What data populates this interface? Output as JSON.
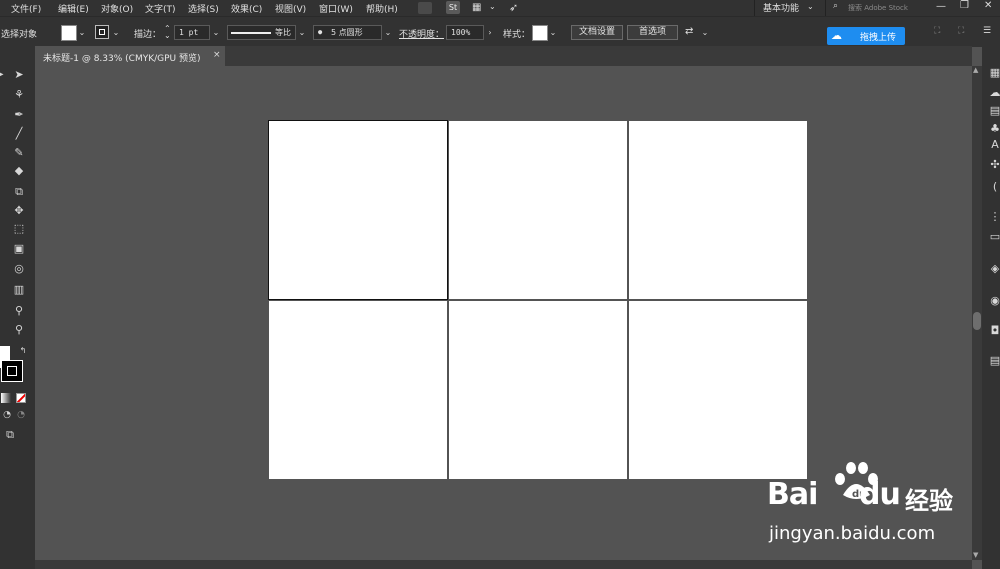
{
  "menu": {
    "items": [
      "文件(F)",
      "编辑(E)",
      "对象(O)",
      "文字(T)",
      "选择(S)",
      "效果(C)",
      "视图(V)",
      "窗口(W)",
      "帮助(H)"
    ],
    "workspace": "基本功能",
    "search_placeholder": "搜索 Adobe Stock",
    "st_label": "St"
  },
  "control": {
    "selection_label": "选择对象",
    "stroke_label": "描边：",
    "stroke_weight": "1 pt",
    "line_profile": "等比",
    "brush": "5 点圆形",
    "opacity_label": "不透明度：",
    "opacity_value": "100%",
    "style_label": "样式：",
    "doc_setup": "文档设置",
    "preferences": "首选项"
  },
  "tab": {
    "title": "未标题-1 @ 8.33% (CMYK/GPU 预览)",
    "close": "×"
  },
  "colors": {
    "app_bg": "#535353",
    "chrome": "#323232",
    "artboard": "#ffffff",
    "baidu_blue": "#1e8df0"
  },
  "artboards": {
    "count": 6,
    "rows": 2,
    "cols": 3,
    "selected_index": 0
  },
  "overlay": {
    "upload_button": "拖拽上传",
    "watermark_brand": "Bai",
    "watermark_brand2": "du",
    "watermark_cn": "经验",
    "watermark_url": "jingyan.baidu.com"
  }
}
